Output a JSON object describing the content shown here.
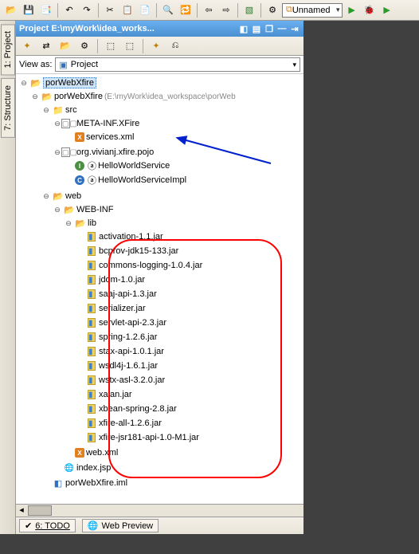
{
  "toolbar": {
    "dropdown_label": "Unnamed"
  },
  "project": {
    "header_title": "Project  E:\\myWork\\idea_works...",
    "view_as_label": "View as:",
    "view_as_value": "Project"
  },
  "tree": {
    "root": "porWebXfire",
    "root2": {
      "name": "porWebXfire",
      "hint": "(E:\\myWork\\idea_workspace\\porWeb"
    },
    "src": "src",
    "meta_inf": "META-INF.XFire",
    "services_xml": "services.xml",
    "pkg": "org.vivianj.xfire.pojo",
    "iface": "HelloWorldService",
    "impl": "HelloWorldServiceImpl",
    "web": "web",
    "web_inf": "WEB-INF",
    "lib": "lib",
    "jars": [
      "activation-1.1.jar",
      "bcprov-jdk15-133.jar",
      "commons-logging-1.0.4.jar",
      "jdom-1.0.jar",
      "saaj-api-1.3.jar",
      "serializer.jar",
      "servlet-api-2.3.jar",
      "spring-1.2.6.jar",
      "stax-api-1.0.1.jar",
      "wsdl4j-1.6.1.jar",
      "wstx-asl-3.2.0.jar",
      "xalan.jar",
      "xbean-spring-2.8.jar",
      "xfire-all-1.2.6.jar",
      "xfire-jsr181-api-1.0-M1.jar"
    ],
    "web_xml": "web.xml",
    "index_jsp": "index.jsp",
    "iml": "porWebXfire.iml"
  },
  "sidebar": {
    "project": "1: Project",
    "structure": "7: Structure"
  },
  "bottom": {
    "todo": "6: TODO",
    "web_preview": "Web Preview"
  }
}
